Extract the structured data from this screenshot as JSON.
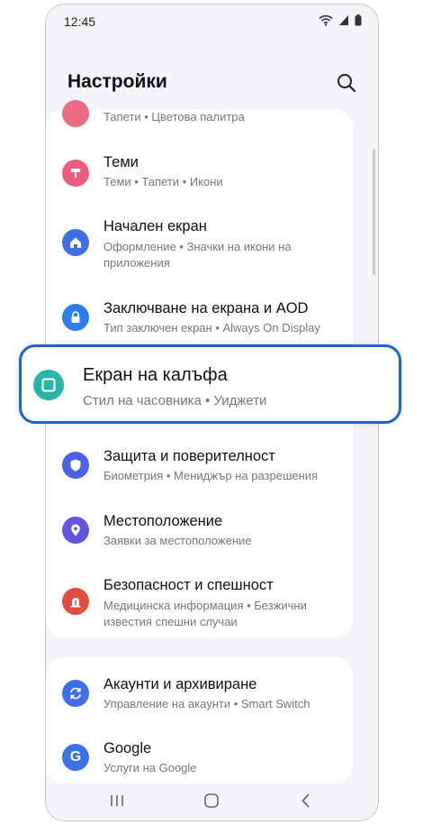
{
  "status": {
    "time": "12:45"
  },
  "header": {
    "title": "Настройки"
  },
  "rows": [
    {
      "sub": "Тапети • Цветова палитра"
    },
    {
      "title": "Теми",
      "sub": "Теми • Тапети • Икони",
      "color": "#ee5c7e"
    },
    {
      "title": "Начален екран",
      "sub": "Оформление • Значки на икони на приложения",
      "color": "#3f6fe5"
    },
    {
      "title": "Заключване на екрана и AOD",
      "sub": "Тип заключен екран • Always On Display",
      "color": "#2f7ef0"
    },
    {
      "title": "Защита и поверителност",
      "sub": "Биометрия • Мениджър на разрешения",
      "color": "#4b62e0"
    },
    {
      "title": "Местоположение",
      "sub": "Заявки за местоположение",
      "color": "#6255e0"
    },
    {
      "title": "Безопасност и спешност",
      "sub": "Медицинска информация • Безжични известия спешни случаи",
      "color": "#e24b43"
    },
    {
      "title": "Акаунти и архивиране",
      "sub": "Управление на акаунти • Smart Switch",
      "color": "#3d70e8"
    },
    {
      "title": "Google",
      "sub": "Услуги на Google",
      "color": "#3b73e6"
    }
  ],
  "highlight": {
    "title": "Екран на калъфа",
    "sub": "Стил на часовника • Уиджети",
    "color": "#2ab3a8"
  }
}
